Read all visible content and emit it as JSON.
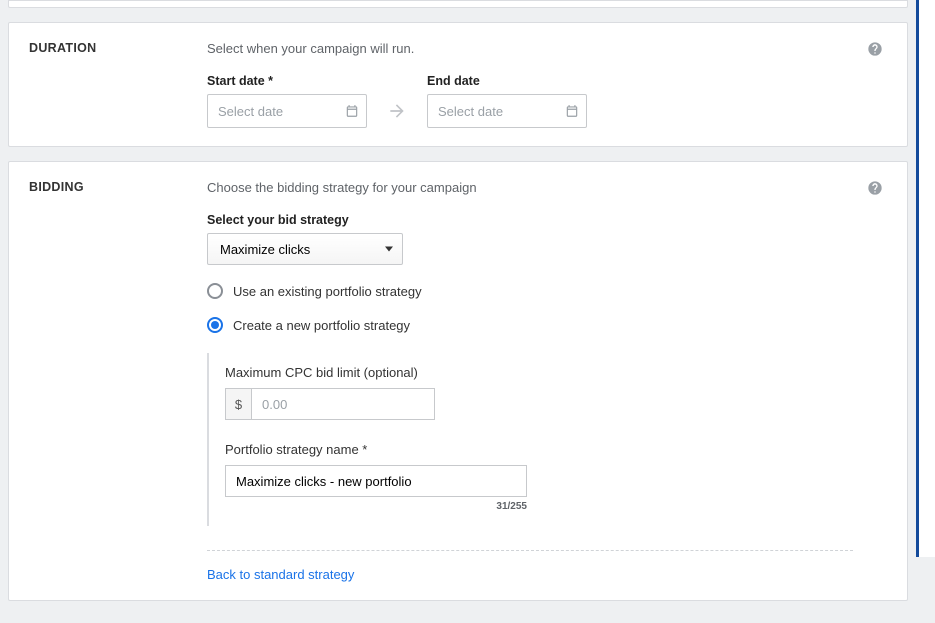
{
  "duration": {
    "title": "DURATION",
    "desc": "Select when your campaign will run.",
    "start_label": "Start date *",
    "end_label": "End date",
    "start_placeholder": "Select date",
    "end_placeholder": "Select date"
  },
  "bidding": {
    "title": "BIDDING",
    "desc": "Choose the bidding strategy for your campaign",
    "select_label": "Select your bid strategy",
    "strategy_value": "Maximize clicks",
    "radio_existing": "Use an existing portfolio strategy",
    "radio_new": "Create a new portfolio strategy",
    "cpc_label": "Maximum CPC bid limit (optional)",
    "cpc_currency": "$",
    "cpc_placeholder": "0.00",
    "name_label": "Portfolio strategy name *",
    "name_value": "Maximize clicks - new portfolio",
    "name_count": "31/255",
    "back_link": "Back to standard strategy"
  }
}
